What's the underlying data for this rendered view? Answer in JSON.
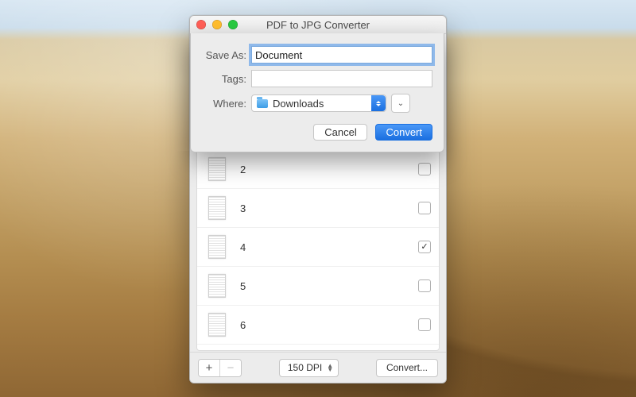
{
  "window": {
    "title": "PDF to JPG Converter"
  },
  "sheet": {
    "saveAsLabel": "Save As:",
    "saveAsValue": "Document",
    "tagsLabel": "Tags:",
    "tagsValue": "",
    "whereLabel": "Where:",
    "whereValue": "Downloads",
    "cancelLabel": "Cancel",
    "confirmLabel": "Convert"
  },
  "pages": [
    {
      "label": "2",
      "checked": false
    },
    {
      "label": "3",
      "checked": false
    },
    {
      "label": "4",
      "checked": true
    },
    {
      "label": "5",
      "checked": false
    },
    {
      "label": "6",
      "checked": false
    }
  ],
  "toolbar": {
    "addGlyph": "+",
    "removeGlyph": "−",
    "dpiLabel": "150 DPI",
    "convertLabel": "Convert..."
  }
}
